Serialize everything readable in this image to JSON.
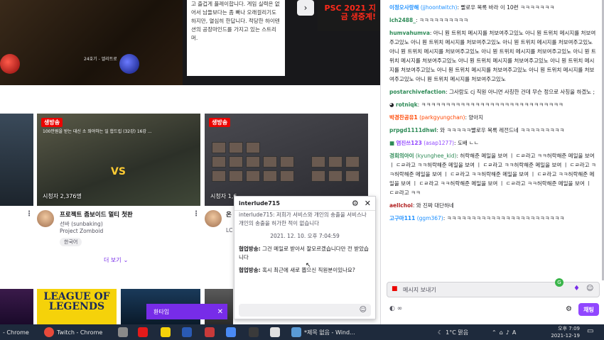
{
  "banner": {
    "game_label": "24호기 - 엘리트로",
    "description": "고 즐겁게 플레이합니다. 게임 실력은 없어서 남들보다는 좀 빠나 오래걸리기도 하지만, 열심히 한답니다. 적당한 하이텐션의 공장마인드를 가지고 있는 스트리머.",
    "next_icon": "chevron-right-icon",
    "ad_text": "PSC 2021 지금 생중계!"
  },
  "cards": {
    "live_label": "생방송",
    "b": {
      "thumb_title": "100만원을 받는 대신 소 좌야하는 일 합드립 (32강) 16강 ...",
      "vs": "VS",
      "viewers": "시청자 2,376명",
      "title": "프로젝트 좀보이드 멀티 첫판",
      "channel": "선바 (sunbaking)",
      "category": "Project Zomboid",
      "tag": "한국어"
    },
    "c": {
      "viewers": "시청자 1,6",
      "title": "온",
      "channel": "LC"
    },
    "show_more": "더 보기"
  },
  "bottom": {
    "lol_text": "LEAGUE OF LEGENDS"
  },
  "whisper": {
    "bar_label": "환타임",
    "window_title": "interlude715",
    "msg0": "interlude715: 저희가 서비스와 개인의 송출을 서비스나 개인의 송출을 허가한 적이 없습니다",
    "timestamp": "2021. 12. 10. 오후 7:04:59",
    "messages": [
      {
        "sender": "협업방송:",
        "text": " 그건 메일로 받아서 잘모르겠습니다만 전 받았습니다"
      },
      {
        "sender": "협업방송:",
        "text": " 혹시 최근에 새로 뽑으신 직원분이있나요?"
      }
    ]
  },
  "chat": {
    "lines": [
      {
        "user": "이정오사랑해",
        "id": " (jjhoontwitch)",
        "text": ": 빨로우 목록 바라 이 10련 ㅋㅋㅋㅋㅋㅋㅋ",
        "color": "#1e90ff"
      },
      {
        "user": "ich2488_",
        "id": "",
        "text": ": ㅋㅋㅋㅋㅋㅋㅋㅋㅋㅋ",
        "color": "#2e8b57"
      },
      {
        "user": "humvahumva",
        "id": "",
        "text": ": 아니 뭔 트위치 메시지를 처보여주고있노 아니 뭔 트위치 메시지를 처보여주고있노 아니 뭔 트위치 메시지를 처보여주고있노 아니 뭔 트위치 메시지를 처보여주고있노 아니 뭔 트위치 메시지를 처보여주고있노 아니 뭔 트위치 메시지를 처보여주고있노 아니 뭔 트위치 메시지를 처보여주고있노 아니 뭔 트위치 메시지를 처보여주고있노 아니 뭔 트위치 메시지를 처보여주고있노 아니 뭔 트위치 메시지를 처보여주고있노 아니 뭔 트위치 메시지를 처보여주고있노 아니 뭔 트위치 메시지를 처보여주고있노",
        "color": "#2e8b57"
      },
      {
        "user": "postarchivefaction",
        "id": "",
        "text": ": 그사람도 cj 직원 아니면 사칭한 건데 무슨 정으로 사칭을 하겠노 ;",
        "color": "#2e8b57"
      },
      {
        "user": "rotniqk",
        "id": "",
        "text": ": ㅋㅋㅋㅋㅋㅋㅋㅋㅋㅋㅋㅋㅋㅋㅋㅋㅋㅋㅋㅋㅋㅋㅋㅋㅋㅋㅋㅋㅋ",
        "color": "#2e8b57"
      },
      {
        "user": "박경찬공유1",
        "id": " (parkgyungchan)",
        "text": ": 양아지",
        "color": "#ff4500"
      },
      {
        "user": "prpgd1111dhwl",
        "id": "",
        "text": ": 와 ㅋㅋㅋㅋㅋ빨로우 목록 레전드네 ㅋㅋㅋㅋㅋㅋㅋㅋㅋ",
        "color": "#2e8b57"
      },
      {
        "user": "염진쓰123",
        "id": " (asap1277)",
        "text": ": 도배 ㄴㄴ",
        "color": "#9147ff"
      },
      {
        "user": "경희의아이",
        "id": " (kyunghee_kid)",
        "text": ": 허락해준 메일을 보여 ㅣ ㄷㄹ라고 ㅋㅋ허락해준 메일을 보여 ㅣ ㄷㄹ라고 ㅋㅋ허락해준 메일을 보여 ㅣ ㄷㄹ라고 ㅋㅋ허락해준 메일을 보여 ㅣ ㄷㄹ라고 ㅋㅋ허락해준 메일을 보여 ㅣ ㄷㄹ라고 ㅋㅋ허락해준 메일을 보여 ㅣ ㄷㄹ라고 ㅋㅋ허락해준 메일을 보여 ㅣ ㄷㄹ라고 ㅋㅋ허락해준 메일을 보여 ㅣ ㄷㄹ라고 ㅋㅋ허락해준 메일을 보여 ㅣ ㄷㄹ라고 ㅋㅋ",
        "color": "#2e8b57"
      },
      {
        "user": "aellchoi",
        "id": "",
        "text": ": 와 진짜 대단하네",
        "color": "#b22222"
      },
      {
        "user": "고구마111",
        "id": " (ggm367)",
        "text": ": ㅋㅋㅋㅋㅋㅋㅋㅋㅋㅋㅋㅋㅋㅋㅋㅋㅋㅋㅋㅋㅋㅋㅋㅋ",
        "color": "#1e90ff"
      }
    ],
    "input_placeholder": "메시지 보내기",
    "send_label": "채팅",
    "footer_left": "∞"
  },
  "taskbar": {
    "items": [
      {
        "label": "- Chrome",
        "color": "#e84a3a"
      },
      {
        "label": "Twitch - Chrome",
        "color": "#4a8af4"
      },
      {
        "label": "*제목 없음 - Wind...",
        "color": "#5a9ad4"
      }
    ],
    "weather": "1°C 맑음",
    "lang": "A",
    "clock_time": "오후 7:09",
    "clock_date": "2021-12-19"
  }
}
